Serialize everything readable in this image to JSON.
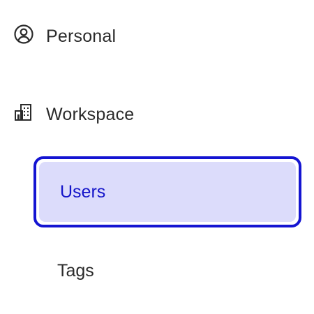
{
  "nav": {
    "personal": {
      "label": "Personal",
      "icon": "user-circle-icon"
    },
    "workspace": {
      "label": "Workspace",
      "icon": "building-icon",
      "items": [
        {
          "label": "Users",
          "selected": true
        },
        {
          "label": "Tags",
          "selected": false
        }
      ]
    }
  },
  "colors": {
    "selected_border": "#1414d2",
    "selected_background": "#dcdcfb",
    "selected_text": "#1515c9",
    "text": "#2b2b2b"
  }
}
